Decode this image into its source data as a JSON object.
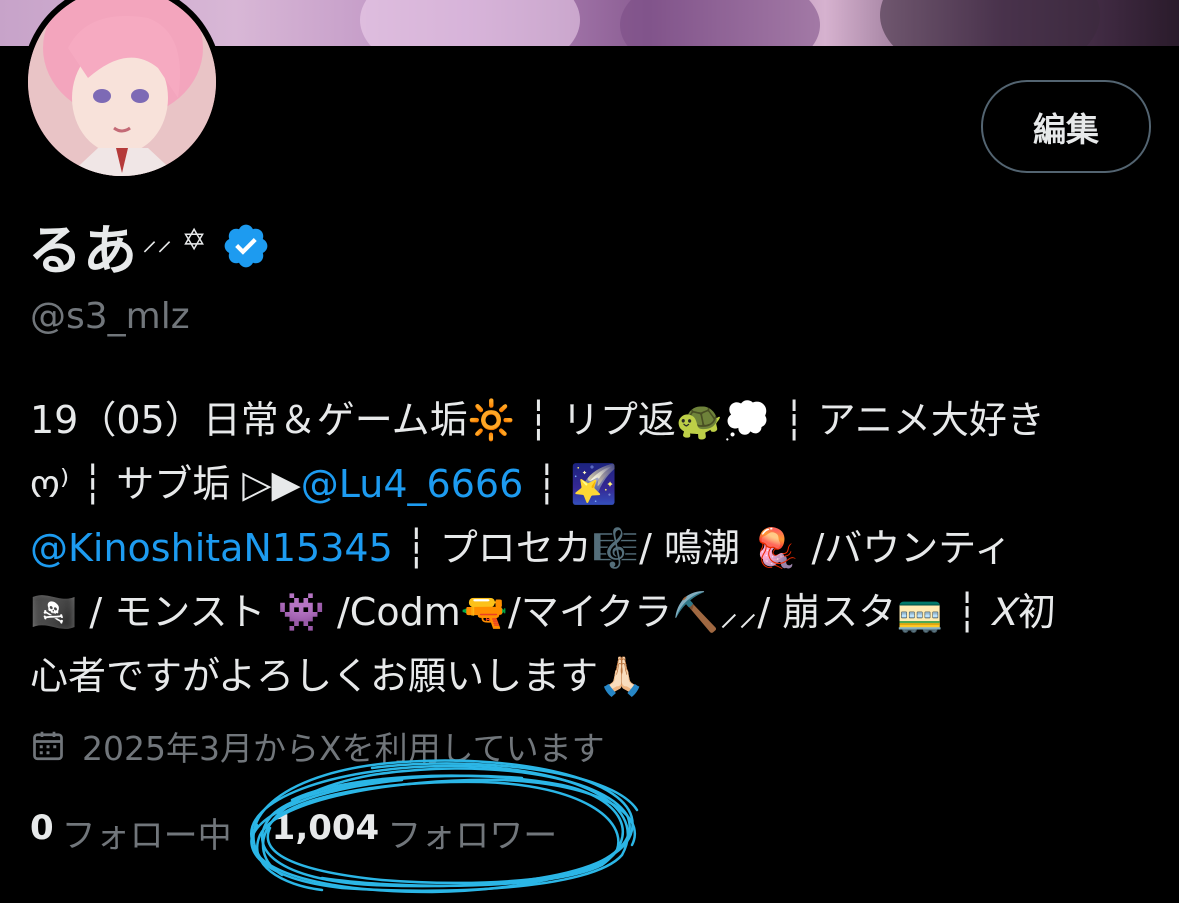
{
  "profile": {
    "edit_label": "編集",
    "display_name": "るあ",
    "name_decoration": "⸝⸝ ✡",
    "handle": "@s3_mlz",
    "bio_line1": "19（05）日常＆ゲーム垢🔆 ┆ リプ返🐢💭 ┆ アニメ大好き",
    "bio_line2_pre": "ო⁾ ┆ サブ垢 ▷▶",
    "bio_mention1": "@Lu4_6666",
    "bio_line2_post": " ┆ 🌠",
    "bio_mention2": "@KinoshitaN15345",
    "bio_line3_post": " ┆ プロセカ🎼/ 鳴潮 🪼 /バウンティ",
    "bio_line4": "🏴‍☠️ / モンスト 👾 /Codm🔫/マイクラ⛏️⸝⸝/ 崩スタ🚃 ┆ 𝑋初",
    "bio_line5": "心者ですがよろしくお願いします🙏🏻",
    "joined": "2025年3月からXを利用しています",
    "following_count": "0",
    "following_label": "フォロー中",
    "followers_count": "1,004",
    "followers_label": "フォロワー"
  },
  "icons": {
    "verified": "verified-badge-icon",
    "calendar": "calendar-icon"
  },
  "colors": {
    "background": "#000000",
    "text": "#e7e9ea",
    "secondary": "#71767b",
    "link": "#1d9bf0",
    "verified": "#1d9bf0",
    "scribble": "#2bb6e6"
  }
}
